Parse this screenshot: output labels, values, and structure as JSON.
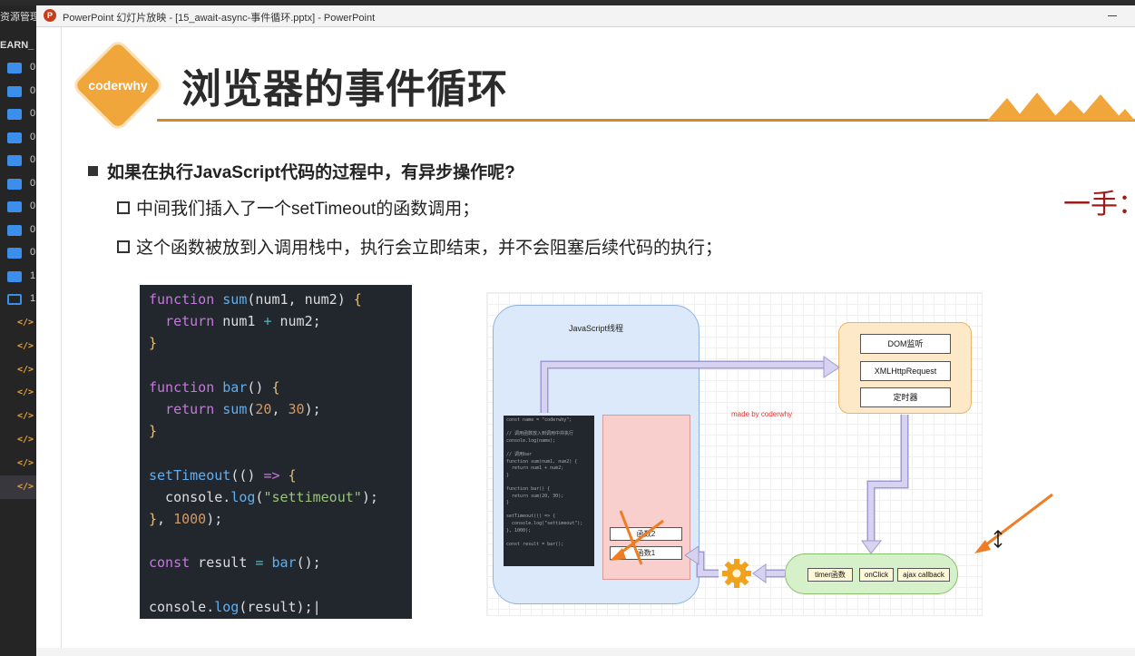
{
  "window": {
    "app_title": "PowerPoint 幻灯片放映 - [15_await-async-事件循环.pptx] - PowerPoint",
    "app_icon": "powerpoint-icon"
  },
  "explorer": {
    "header": "资源管理",
    "root_label": "EARN_",
    "folders": [
      {
        "name": "0",
        "icon": "folder-icon"
      },
      {
        "name": "0",
        "icon": "folder-icon"
      },
      {
        "name": "0",
        "icon": "folder-icon"
      },
      {
        "name": "0",
        "icon": "folder-icon"
      },
      {
        "name": "0",
        "icon": "folder-icon"
      },
      {
        "name": "0",
        "icon": "folder-icon"
      },
      {
        "name": "0",
        "icon": "folder-icon"
      },
      {
        "name": "0",
        "icon": "folder-icon"
      },
      {
        "name": "0",
        "icon": "folder-icon"
      },
      {
        "name": "1",
        "icon": "folder-icon"
      },
      {
        "name": "1",
        "icon": "folder-open-icon"
      }
    ],
    "file_icon_glyph": "</>"
  },
  "slide": {
    "badge": "coderwhy",
    "title": "浏览器的事件循环",
    "bullet_main": "如果在执行JavaScript代码的过程中，有异步操作呢?",
    "sub_bullets": [
      "中间我们插入了一个setTimeout的函数调用；",
      "这个函数被放到入调用栈中，执行会立即结束，并不会阻塞后续代码的执行；"
    ],
    "handwritten_note": "一手："
  },
  "diagram": {
    "js_thread_label": "JavaScript线程",
    "web_apis": [
      "DOM监听",
      "XMLHttpRequest",
      "定时器"
    ],
    "stack_frames": [
      "函数2",
      "函数1"
    ],
    "queue_items": [
      "timer函数",
      "onClick",
      "ajax callback"
    ],
    "watermark": "made by coderwhy",
    "mini_code": "const name = \"coderwhy\";\n\n// 调用函数放入到调用中并执行\nconsole.log(name);\n\n// 调用bar\nfunction sum(num1, num2) {\n  return num1 + num2;\n}\n\nfunction bar() {\n  return sum(20, 30);\n}\n\nsetTimeout(() => {\n  console.log(\"settimeout\");\n}, 1000);\n\nconst result = bar();",
    "colors": {
      "thread": "#dbe9fb",
      "stack": "#f8cfcc",
      "web_api": "#fde8c8",
      "queue": "#d6f0c9",
      "arrow": "#c7c2e8",
      "annotation": "#f07d24"
    }
  },
  "theme": {
    "accent": "#f0a63a",
    "title_rule": "#d48a2c"
  }
}
